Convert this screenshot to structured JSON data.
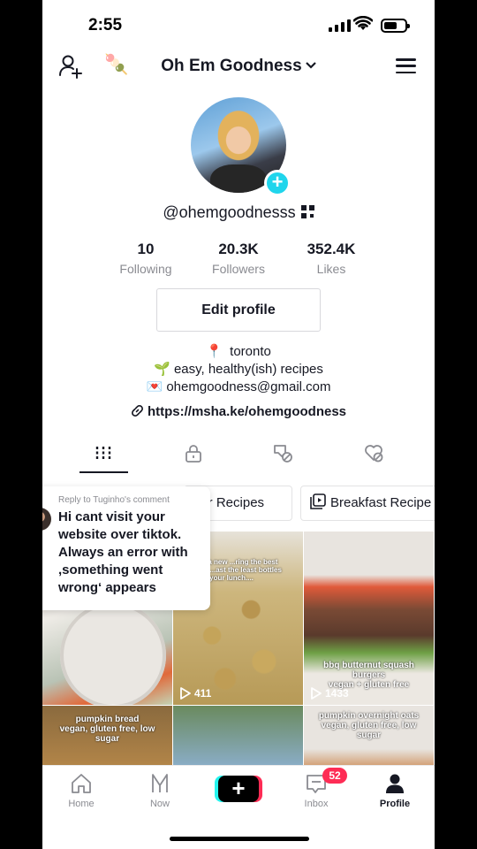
{
  "status_bar": {
    "time": "2:55"
  },
  "header": {
    "title": "Oh Em Goodness",
    "popsicle_emoji": "🍡"
  },
  "profile": {
    "handle": "@ohemgoodnesss",
    "stats": [
      {
        "value": "10",
        "label": "Following"
      },
      {
        "value": "20.3K",
        "label": "Followers"
      },
      {
        "value": "352.4K",
        "label": "Likes"
      }
    ],
    "edit_label": "Edit profile",
    "bio": [
      {
        "emoji": "📍",
        "text": "toronto"
      },
      {
        "emoji": "🌱",
        "text": "easy, healthy(ish) recipes"
      },
      {
        "emoji": "💌",
        "text": "ohemgoodness@gmail.com"
      }
    ],
    "link": "https://msha.ke/ohemgoodness"
  },
  "tabs": [
    {
      "icon": "grid-icon",
      "active": true
    },
    {
      "icon": "lock-icon",
      "active": false
    },
    {
      "icon": "tag-hidden-icon",
      "active": false
    },
    {
      "icon": "liked-hidden-icon",
      "active": false
    }
  ],
  "playlists": [
    "ner Recipes",
    "Breakfast Recipe"
  ],
  "videos": [
    {
      "caption": "",
      "views": ""
    },
    {
      "caption": "...ting to a new ...ring the best hummus ...ast the least bottles ...ktok of your lunch....",
      "views": "411"
    },
    {
      "caption": "bbq butternut squash burgers\nvegan + gluten free",
      "views": "1433"
    },
    {
      "caption": "pumpkin bread\nvegan, gluten free, low sugar",
      "views": ""
    },
    {
      "caption": "",
      "views": ""
    },
    {
      "caption": "pumpkin overnight oats\nvegan, gluten free, low sugar",
      "views": ""
    }
  ],
  "reply_bubble": {
    "reply_to": "Reply to Tuginho's comment",
    "body": "Hi cant visit your website over tiktok. Always an error with ,something went wrong‘ appears"
  },
  "bottom_nav": [
    {
      "label": "Home",
      "icon": "home-icon"
    },
    {
      "label": "Now",
      "icon": "now-icon"
    },
    {
      "label": "",
      "icon": "create-plus-icon"
    },
    {
      "label": "Inbox",
      "icon": "inbox-icon",
      "badge": "52"
    },
    {
      "label": "Profile",
      "icon": "profile-icon"
    }
  ],
  "colors": {
    "accent_cyan": "#20d5ec",
    "badge_red": "#fe2c55",
    "text": "#161823",
    "muted": "#8a8b91"
  }
}
